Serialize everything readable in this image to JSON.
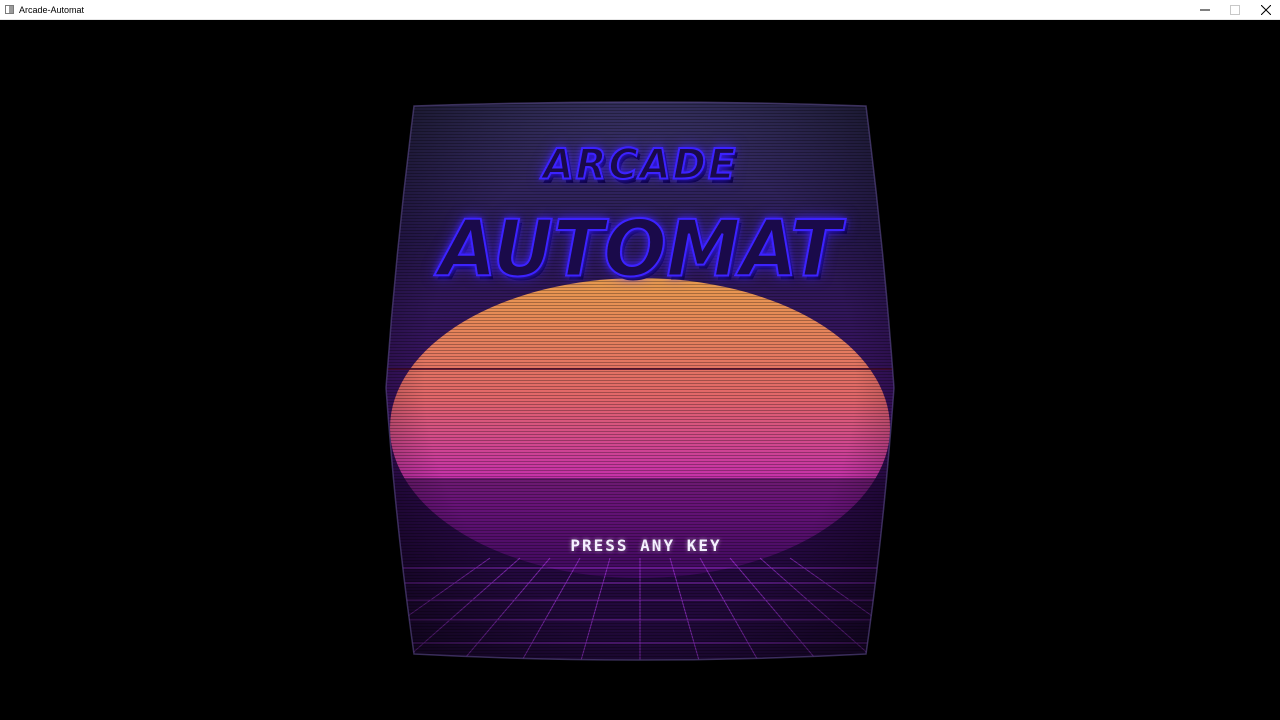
{
  "window": {
    "title": "Arcade-Automat",
    "icon": "app-window-icon",
    "controls": {
      "minimize": "minimize-icon",
      "maximize": "maximize-icon",
      "close": "close-icon"
    }
  },
  "screen": {
    "logo_line1": "ARCADE",
    "logo_line2": "AUTOMAT",
    "prompt": "PRESS ANY KEY",
    "colors": {
      "background": "#000000",
      "logo": "#3c22ff",
      "sun_top": "#f0a050",
      "sun_bottom": "#c020c8",
      "grid": "#c040ff"
    }
  }
}
